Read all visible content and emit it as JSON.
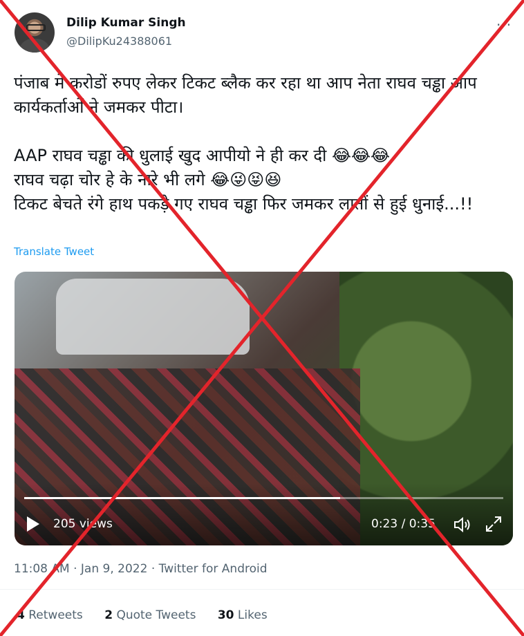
{
  "author": {
    "name": "Dilip Kumar Singh",
    "handle": "@DilipKu24388061"
  },
  "tweet": {
    "text": "पंजाब मे करोडों रुपए लेकर टिकट ब्लैक कर रहा था आप नेता राघव चड्ढा आप कार्यकर्ताओं ने जमकर पीटा।\n\nAAP राघव चड्ढा की धुलाई खुद आपीयो ने ही कर दी 😂😂😂\nराघव चढ़ा चोर हे के नारे भी लगे 😂😜😝😆\nटिकट बेचते रंगे हाथ पकड़े गए राघव चड्ढा फिर जमकर लातों से हुई धुनाई...!!",
    "translate_label": "Translate Tweet"
  },
  "video": {
    "views": "205 views",
    "time": "0:23 / 0:35",
    "progress": 0.66
  },
  "meta": {
    "time": "11:08 AM",
    "separator1": " · ",
    "date": "Jan 9, 2022",
    "separator2": " · ",
    "source": "Twitter for Android"
  },
  "stats": {
    "retweets_count": "4",
    "retweets_label": "Retweets",
    "quotes_count": "2",
    "quotes_label": "Quote Tweets",
    "likes_count": "30",
    "likes_label": "Likes"
  },
  "colors": {
    "link": "#1d9bf0",
    "cross": "#e3242b",
    "secondary_text": "#536471"
  },
  "icons": [
    "more-icon",
    "play-icon",
    "volume-icon",
    "fullscreen-icon"
  ]
}
